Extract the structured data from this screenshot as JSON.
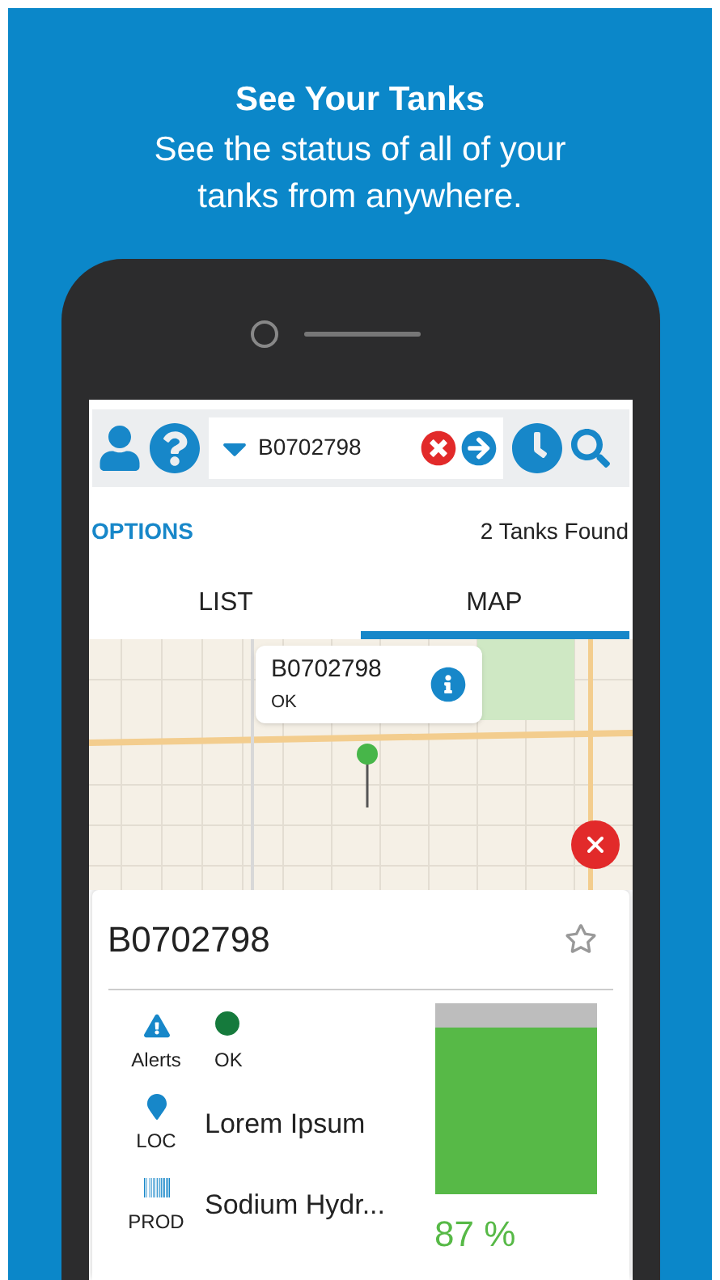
{
  "promo": {
    "title": "See Your Tanks",
    "subtitle": "See the status of all of your tanks from anywhere."
  },
  "toolbar": {
    "search_value": "B0702798"
  },
  "options_label": "OPTIONS",
  "result_count": "2 Tanks Found",
  "tabs": [
    {
      "label": "LIST",
      "selected": false
    },
    {
      "label": "MAP",
      "selected": true
    }
  ],
  "map": {
    "callout": {
      "title": "B0702798",
      "status": "OK"
    }
  },
  "tank_card": {
    "title": "B0702798",
    "favorite": false,
    "rows": [
      {
        "label": "Alerts",
        "kind": "status",
        "value": "OK",
        "color": "#157a3c"
      },
      {
        "label": "LOC",
        "kind": "text",
        "value": "Lorem Ipsum"
      },
      {
        "label": "PROD",
        "kind": "text",
        "value": "Sodium Hydr..."
      }
    ],
    "level": 0.87,
    "reading": "87 %"
  }
}
